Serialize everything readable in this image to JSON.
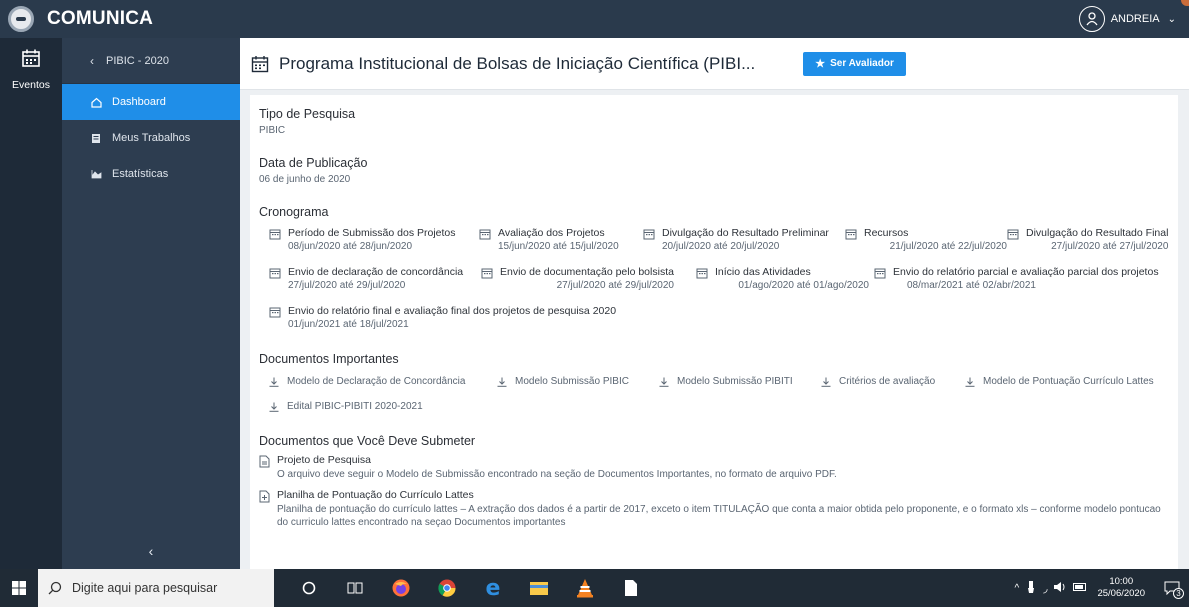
{
  "app": {
    "name": "COMUNICA"
  },
  "user": {
    "name": "ANDREIA"
  },
  "rail": {
    "eventos_label": "Eventos"
  },
  "sidebar": {
    "back_label": "PIBIC - 2020",
    "items": [
      {
        "label": "Dashboard",
        "icon": "home-icon",
        "active": true
      },
      {
        "label": "Meus Trabalhos",
        "icon": "document-icon",
        "active": false
      },
      {
        "label": "Estatísticas",
        "icon": "chart-icon",
        "active": false
      }
    ],
    "collapse_glyph": "‹"
  },
  "header": {
    "title": "Programa Institucional de Bolsas de Iniciação Científica (PIBI...",
    "button_label": "Ser Avaliador"
  },
  "content": {
    "tipo": {
      "heading": "Tipo de Pesquisa",
      "value": "PIBIC"
    },
    "data_pub": {
      "heading": "Data de Publicação",
      "value": "06 de junho de 2020"
    },
    "cronograma": {
      "heading": "Cronograma",
      "items": [
        {
          "name": "Período de Submissão dos Projetos",
          "dates": "08/jun/2020 até 28/jun/2020"
        },
        {
          "name": "Avaliação dos Projetos",
          "dates": "15/jun/2020 até 15/jul/2020"
        },
        {
          "name": "Divulgação do Resultado Preliminar",
          "dates": "20/jul/2020 até 20/jul/2020"
        },
        {
          "name": "Recursos",
          "dates": "21/jul/2020 até 22/jul/2020"
        },
        {
          "name": "Divulgação do Resultado Final",
          "dates": "27/jul/2020 até 27/jul/2020"
        },
        {
          "name": "Envio de declaração de concordância",
          "dates": "27/jul/2020 até 29/jul/2020"
        },
        {
          "name": "Envio de documentação pelo bolsista",
          "dates": "27/jul/2020 até 29/jul/2020"
        },
        {
          "name": "Início das Atividades",
          "dates": "01/ago/2020 até 01/ago/2020"
        },
        {
          "name": "Envio do relatório parcial e avaliação parcial dos projetos",
          "dates": "08/mar/2021 até 02/abr/2021"
        },
        {
          "name": "Envio do relatório final e avaliação final dos projetos de pesquisa 2020",
          "dates": "01/jun/2021 até 18/jul/2021"
        }
      ]
    },
    "documentos": {
      "heading": "Documentos Importantes",
      "items": [
        "Modelo de Declaração de Concordância",
        "Modelo Submissão PIBIC",
        "Modelo Submissão PIBITI",
        "Critérios de avaliação",
        "Modelo de Pontuação Currículo Lattes",
        "Edital PIBIC-PIBITI 2020-2021"
      ]
    },
    "submeter": {
      "heading": "Documentos que Você Deve Submeter",
      "items": [
        {
          "name": "Projeto de Pesquisa",
          "desc": "O arquivo deve seguir o Modelo de Submissão encontrado na seção de Documentos Importantes, no formato de arquivo PDF."
        },
        {
          "name": "Planilha de Pontuação do Currículo Lattes",
          "desc": "Planilha de pontuação do currículo lattes – A extração dos dados é a partir de 2017, exceto o item TITULAÇÃO que conta a maior obtida pelo proponente, e o formato xls – conforme modelo pontucao do curriculo lattes encontrado na seçao Documentos importantes"
        }
      ]
    }
  },
  "taskbar": {
    "search_placeholder": "Digite aqui para pesquisar",
    "time": "10:00",
    "date": "25/06/2020",
    "notif_count": "3"
  },
  "colors": {
    "accent": "#1f8ee8",
    "topbar": "#2a3a4c",
    "sidebar": "#2d3d50",
    "rail": "#1e2a38"
  }
}
